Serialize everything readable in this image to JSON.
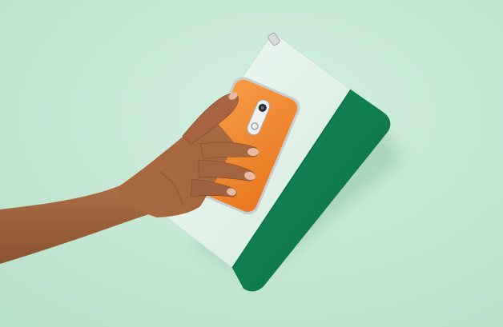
{
  "photo": {
    "alt": "",
    "colors": {
      "background": "#bfe4cf",
      "background_light": "#d4efe0",
      "pouch_light_panel": "#e2f4ea",
      "pouch_dark_panel": "#0f7a4e",
      "pouch_dark_shade": "#0a5c3a",
      "phone_back": "#f58a2e",
      "phone_back_shade": "#e26f16",
      "phone_frame": "#c9cdd0",
      "skin": "#a8683f",
      "skin_shadow": "#7e4a2a",
      "nails": "#e9b9a2"
    }
  }
}
